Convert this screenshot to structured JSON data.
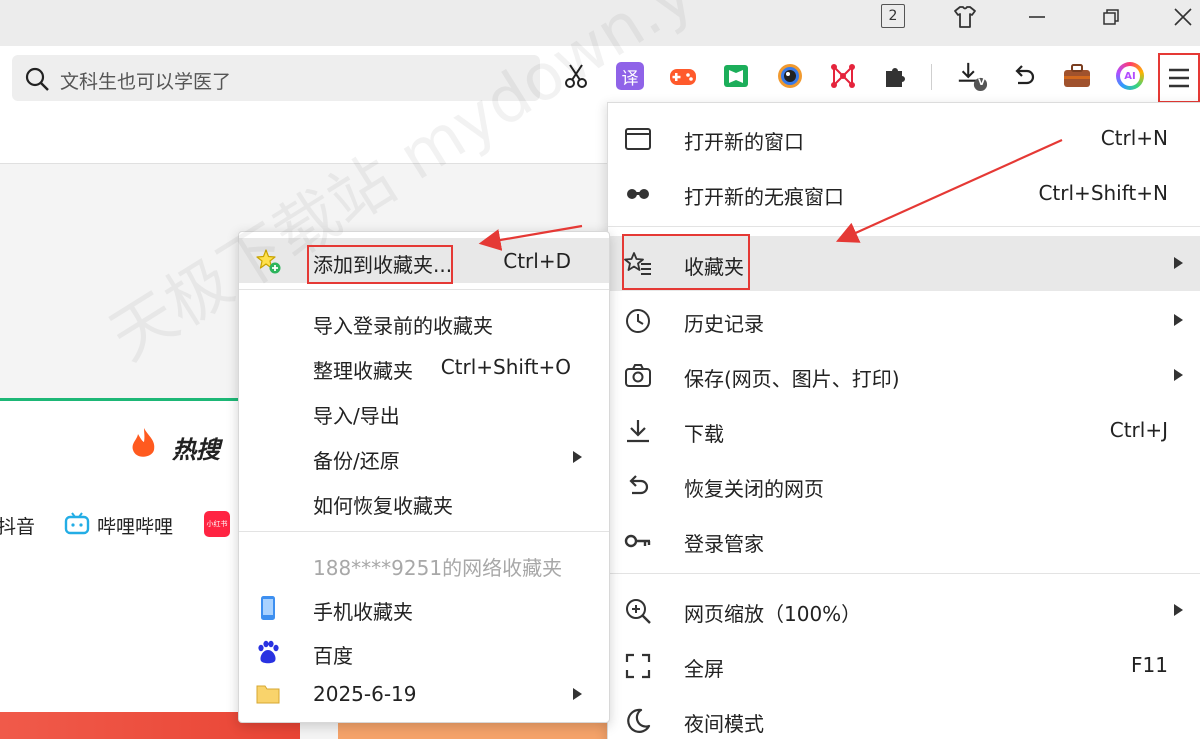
{
  "titlebar": {
    "tab_count": "2",
    "icons": [
      "tab-count-icon",
      "shirt-icon",
      "minimize-icon",
      "restore-icon",
      "close-icon"
    ]
  },
  "search": {
    "value": "文科生也可以学医了"
  },
  "toolbar": {
    "icons": [
      "scissors-icon",
      "translate-icon",
      "game-icon",
      "book-icon",
      "camera-lens-icon",
      "network-icon",
      "puzzle-extension-icon",
      "download-icon",
      "undo-icon",
      "briefcase-icon",
      "ai-icon",
      "hamburger-menu-icon"
    ],
    "translate_glyph": "译",
    "ai_glyph": "AI",
    "download_badge": "V"
  },
  "page": {
    "hot_title": "热搜",
    "links": [
      "抖音",
      "哔哩哔哩",
      "小红书"
    ]
  },
  "main_menu": {
    "items": [
      {
        "label": "打开新的窗口",
        "shortcut": "Ctrl+N",
        "icon": "window-icon"
      },
      {
        "label": "打开新的无痕窗口",
        "shortcut": "Ctrl+Shift+N",
        "icon": "incognito-icon"
      },
      {
        "label": "收藏夹",
        "shortcut": "",
        "icon": "bookmarks-star-icon"
      },
      {
        "label": "历史记录",
        "shortcut": "",
        "icon": "history-clock-icon"
      },
      {
        "label": "保存(网页、图片、打印)",
        "shortcut": "",
        "icon": "camera-icon"
      },
      {
        "label": "下载",
        "shortcut": "Ctrl+J",
        "icon": "download-icon"
      },
      {
        "label": "恢复关闭的网页",
        "shortcut": "",
        "icon": "restore-tab-icon"
      },
      {
        "label": "登录管家",
        "shortcut": "",
        "icon": "key-icon"
      },
      {
        "label": "网页缩放（100%）",
        "shortcut": "",
        "icon": "zoom-icon"
      },
      {
        "label": "全屏",
        "shortcut": "F11",
        "icon": "fullscreen-icon"
      },
      {
        "label": "夜间模式",
        "shortcut": "",
        "icon": "moon-icon"
      }
    ]
  },
  "bookmarks_menu": {
    "items": [
      {
        "label": "添加到收藏夹...",
        "shortcut": "Ctrl+D",
        "icon": "add-star-icon"
      },
      {
        "label": "导入登录前的收藏夹",
        "shortcut": ""
      },
      {
        "label": "整理收藏夹",
        "shortcut": "Ctrl+Shift+O"
      },
      {
        "label": "导入/导出",
        "shortcut": ""
      },
      {
        "label": "备份/还原",
        "shortcut": ""
      },
      {
        "label": "如何恢复收藏夹",
        "shortcut": ""
      },
      {
        "label": "188****9251的网络收藏夹",
        "shortcut": ""
      },
      {
        "label": "手机收藏夹",
        "shortcut": "",
        "icon": "phone-icon"
      },
      {
        "label": "百度",
        "shortcut": "",
        "icon": "baidu-paw-icon"
      },
      {
        "label": "2025-6-19",
        "shortcut": "",
        "icon": "folder-icon"
      }
    ]
  },
  "colors": {
    "highlight_red": "#e53935",
    "menu_highlight": "#e8e8e8",
    "hot_green": "#1db776"
  },
  "watermark": "天极下载站 mydown.yesky.com"
}
